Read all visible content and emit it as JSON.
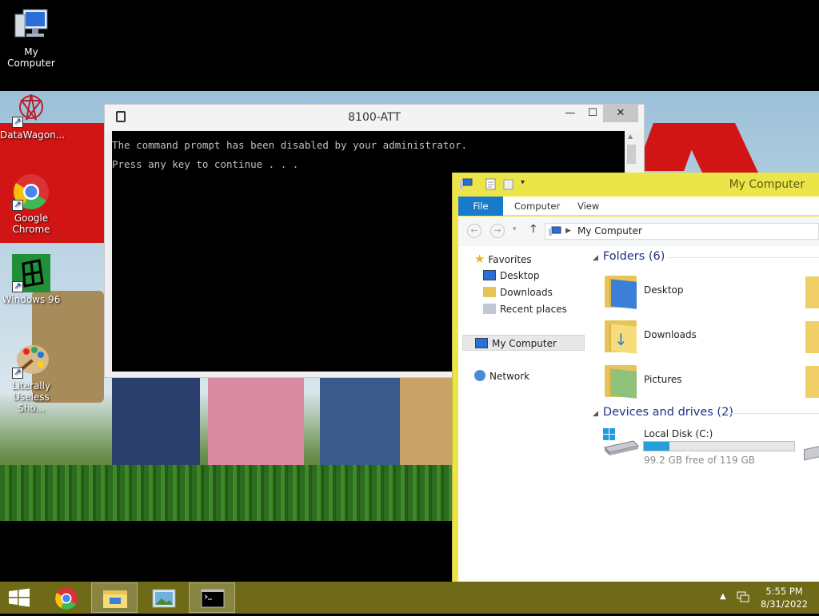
{
  "desktop": {
    "icons": [
      {
        "label": "My Computer"
      },
      {
        "label": "DataWagon..."
      },
      {
        "label": "Google Chrome"
      },
      {
        "label": "Windows 96"
      },
      {
        "label": "Literally Useless Sho..."
      }
    ]
  },
  "cmd_window": {
    "title": "8100-ATT",
    "lines": [
      "The command prompt has been disabled by your administrator.",
      "Press any key to continue . . ."
    ]
  },
  "explorer": {
    "title": "My Computer",
    "ribbon_tabs": [
      "File",
      "Computer",
      "View"
    ],
    "address": "My Computer",
    "nav_pane": {
      "favorites": "Favorites",
      "favorites_items": [
        "Desktop",
        "Downloads",
        "Recent places"
      ],
      "my_computer": "My Computer",
      "network": "Network"
    },
    "folders_header": "Folders (6)",
    "folders": [
      "Desktop",
      "Downloads",
      "Pictures"
    ],
    "devices_header": "Devices and drives (2)",
    "drive": {
      "name": "Local Disk (C:)",
      "free_text": "99.2 GB free of 119 GB",
      "used_fraction": 0.17
    }
  },
  "taskbar": {
    "time": "5:55 PM",
    "date": "8/31/2022"
  },
  "colors": {
    "explorer_frame": "#ece54a",
    "taskbar": "#6e6a18",
    "file_tab": "#1979ca",
    "section_header": "#1e3287"
  }
}
